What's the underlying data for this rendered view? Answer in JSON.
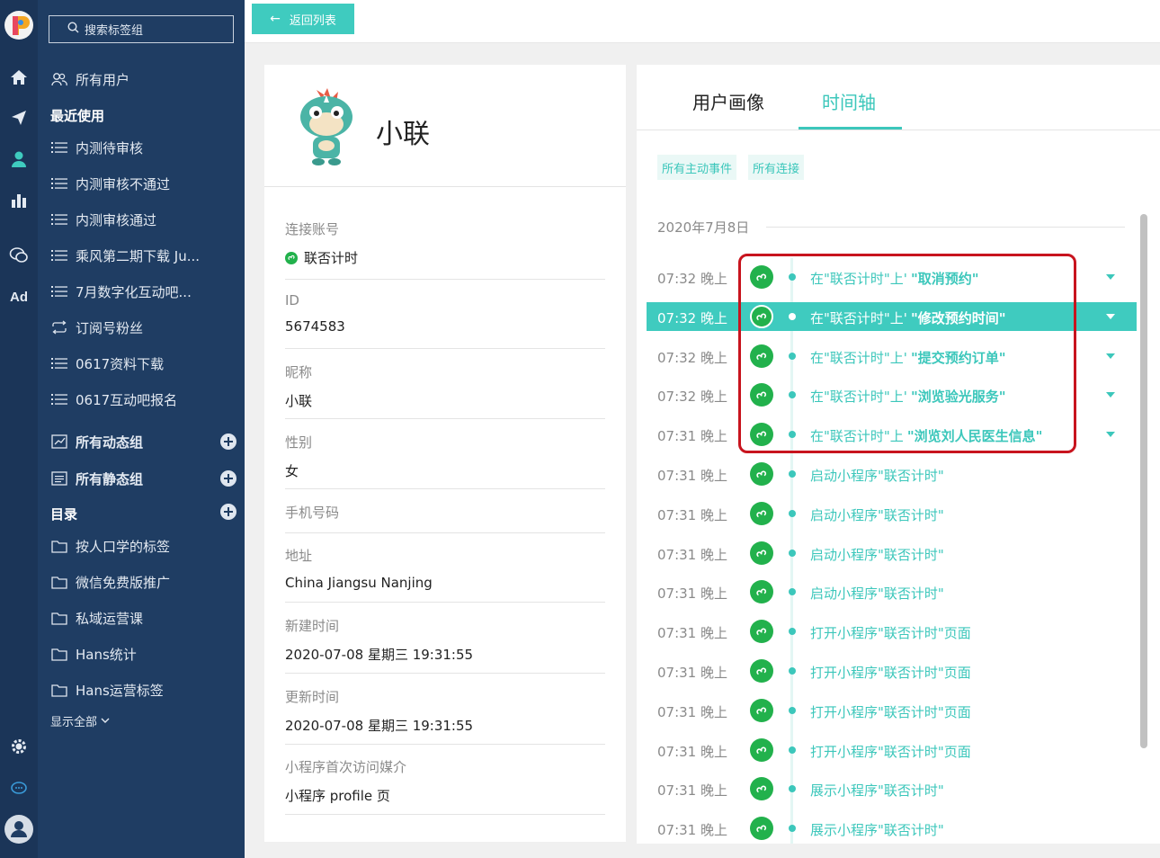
{
  "sidebar": {
    "search_placeholder": "搜索标签组",
    "all_users": "所有用户",
    "recent_heading": "最近使用",
    "recent_items": [
      "内测待审核",
      "内测审核不通过",
      "内测审核通过",
      "乘风第二期下载 Ju...",
      "7月数字化互动吧...",
      "订阅号粉丝",
      "0617资料下载",
      "0617互动吧报名"
    ],
    "dynamic_groups": "所有动态组",
    "static_groups": "所有静态组",
    "catalog_heading": "目录",
    "catalog_items": [
      "按人口学的标签",
      "微信免费版推广",
      "私域运营课",
      "Hans统计",
      "Hans运营标签"
    ],
    "show_all": "显示全部"
  },
  "rail": {
    "ad_label": "Ad"
  },
  "topbar": {
    "back_label": "返回列表"
  },
  "profile": {
    "name": "小联",
    "fields": [
      {
        "label": "连接账号",
        "value": "联否计时"
      },
      {
        "label": "ID",
        "value": "5674583"
      },
      {
        "label": "昵称",
        "value": "小联"
      },
      {
        "label": "性别",
        "value": "女"
      },
      {
        "label": "手机号码",
        "value": ""
      },
      {
        "label": "地址",
        "value": "China Jiangsu Nanjing"
      },
      {
        "label": "新建时间",
        "value": "2020-07-08 星期三 19:31:55"
      },
      {
        "label": "更新时间",
        "value": "2020-07-08 星期三 19:31:55"
      },
      {
        "label": "小程序首次访问媒介",
        "value": "小程序 profile 页"
      }
    ]
  },
  "timeline": {
    "tabs": [
      "用户画像",
      "时间轴"
    ],
    "active_tab": "时间轴",
    "filters": [
      "所有主动事件",
      "所有连接"
    ],
    "date": "2020年7月8日",
    "events": [
      {
        "time": "07:32 晚上",
        "prefix": "在\"联否计时\"上'",
        "action": "\"取消预约\"",
        "highlighted": false
      },
      {
        "time": "07:32 晚上",
        "prefix": "在\"联否计时\"上'",
        "action": "\"修改预约时间\"",
        "highlighted": true
      },
      {
        "time": "07:32 晚上",
        "prefix": "在\"联否计时\"上'",
        "action": "\"提交预约订单\"",
        "highlighted": false
      },
      {
        "time": "07:32 晚上",
        "prefix": "在\"联否计时\"上'",
        "action": "\"浏览验光服务\"",
        "highlighted": false
      },
      {
        "time": "07:31 晚上",
        "prefix": "在\"联否计时\"上",
        "action": "\"浏览刘人民医生信息\"",
        "highlighted": false
      },
      {
        "time": "07:31 晚上",
        "prefix": "启动小程序\"联否计时\"",
        "action": "",
        "highlighted": false
      },
      {
        "time": "07:31 晚上",
        "prefix": "启动小程序\"联否计时\"",
        "action": "",
        "highlighted": false
      },
      {
        "time": "07:31 晚上",
        "prefix": "启动小程序\"联否计时\"",
        "action": "",
        "highlighted": false
      },
      {
        "time": "07:31 晚上",
        "prefix": "启动小程序\"联否计时\"",
        "action": "",
        "highlighted": false
      },
      {
        "time": "07:31 晚上",
        "prefix": "打开小程序\"联否计时\"页面",
        "action": "",
        "highlighted": false
      },
      {
        "time": "07:31 晚上",
        "prefix": "打开小程序\"联否计时\"页面",
        "action": "",
        "highlighted": false
      },
      {
        "time": "07:31 晚上",
        "prefix": "打开小程序\"联否计时\"页面",
        "action": "",
        "highlighted": false
      },
      {
        "time": "07:31 晚上",
        "prefix": "打开小程序\"联否计时\"页面",
        "action": "",
        "highlighted": false
      },
      {
        "time": "07:31 晚上",
        "prefix": "展示小程序\"联否计时\"",
        "action": "",
        "highlighted": false
      },
      {
        "time": "07:31 晚上",
        "prefix": "展示小程序\"联否计时\"",
        "action": "",
        "highlighted": false
      }
    ]
  },
  "colors": {
    "accent": "#3fcbbf",
    "sidebar_bg": "#1f3d63",
    "rail_bg": "#1b3558",
    "miniprogram_green": "#22b14c",
    "annotation_red": "#c8141e"
  },
  "icons": {
    "rail": [
      "logo-icon",
      "home-icon",
      "send-icon",
      "user-icon",
      "bar-chart-icon",
      "wechat-icon",
      "ad-icon",
      "settings-icon",
      "chat-icon",
      "account-icon"
    ],
    "sidebar": [
      "search-icon",
      "users-icon",
      "list-icon",
      "loop-icon",
      "folder-icon",
      "plus-circle-icon",
      "chevron-down-icon"
    ],
    "timeline": [
      "miniprogram-icon",
      "caret-down-icon",
      "arrow-left-icon"
    ]
  }
}
